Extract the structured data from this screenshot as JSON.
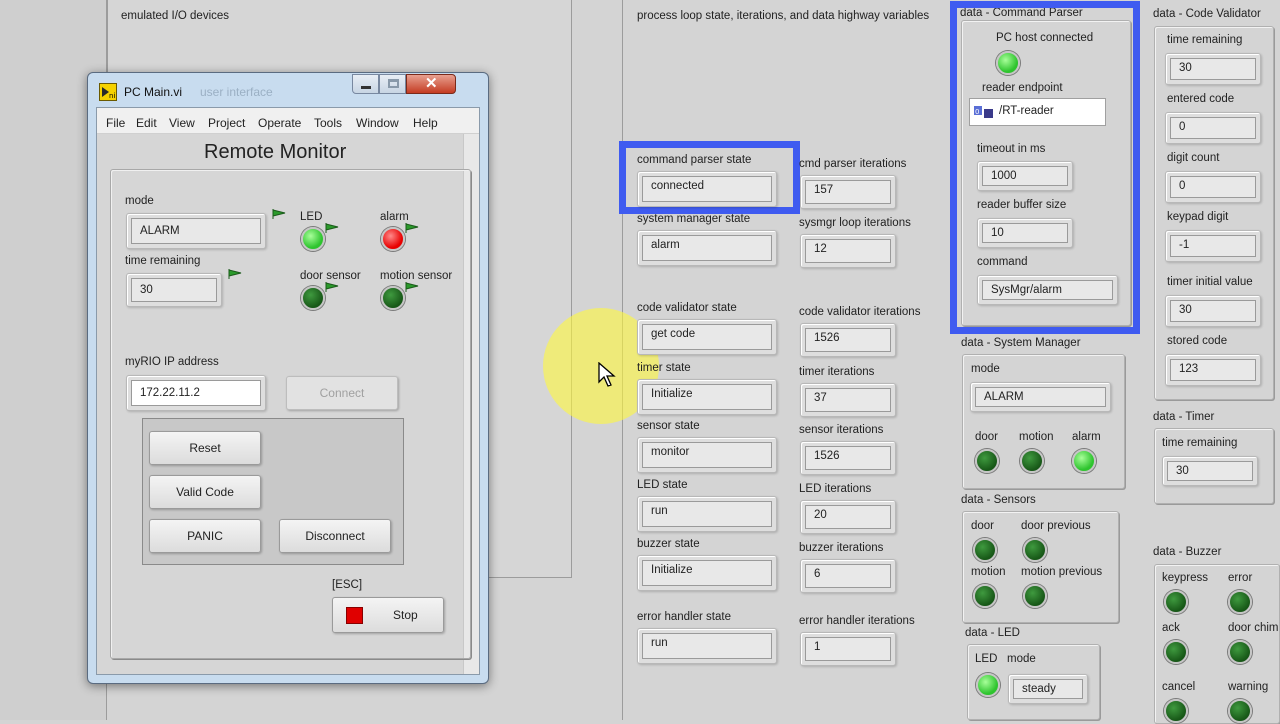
{
  "background": {
    "emulated_label": "emulated I/O devices",
    "process_label": "process loop state, iterations, and data highway variables"
  },
  "window": {
    "title": "PC Main.vi",
    "faded_title": "user interface",
    "menu": [
      "File",
      "Edit",
      "View",
      "Project",
      "Operate",
      "Tools",
      "Window",
      "Help"
    ],
    "heading": "Remote Monitor",
    "mode_label": "mode",
    "mode_value": "ALARM",
    "time_label": "time remaining",
    "time_value": "30",
    "led_label": "LED",
    "alarm_label": "alarm",
    "door_label": "door sensor",
    "motion_label": "motion sensor",
    "ip_label": "myRIO IP address",
    "ip_value": "172.22.11.2",
    "connect": "Connect",
    "reset": "Reset",
    "valid_code": "Valid Code",
    "panic": "PANIC",
    "disconnect": "Disconnect",
    "esc": "[ESC]",
    "stop": "Stop"
  },
  "states": [
    {
      "label": "command parser state",
      "value": "connected"
    },
    {
      "label": "system manager state",
      "value": "alarm"
    },
    {
      "label": "code validator state",
      "value": "get code"
    },
    {
      "label": "timer state",
      "value": "Initialize"
    },
    {
      "label": "sensor state",
      "value": "monitor"
    },
    {
      "label": "LED state",
      "value": "run"
    },
    {
      "label": "buzzer state",
      "value": "Initialize"
    },
    {
      "label": "error handler state",
      "value": "run"
    }
  ],
  "iterations": [
    {
      "label": "cmd parser iterations",
      "value": "157"
    },
    {
      "label": "sysmgr loop iterations",
      "value": "12"
    },
    {
      "label": "code validator iterations",
      "value": "1526"
    },
    {
      "label": "timer iterations",
      "value": "37"
    },
    {
      "label": "sensor iterations",
      "value": "1526"
    },
    {
      "label": "LED iterations",
      "value": "20"
    },
    {
      "label": "buzzer iterations",
      "value": "6"
    },
    {
      "label": "error handler iterations",
      "value": "1"
    }
  ],
  "cmd_parser": {
    "title": "data - Command Parser",
    "pc_host_label": "PC host connected",
    "endpoint_label": "reader endpoint",
    "endpoint_value": "/RT-reader",
    "timeout_label": "timeout in ms",
    "timeout_value": "1000",
    "buffer_label": "reader buffer size",
    "buffer_value": "10",
    "command_label": "command",
    "command_value": "SysMgr/alarm"
  },
  "sys_manager": {
    "title": "data - System Manager",
    "mode_label": "mode",
    "mode_value": "ALARM",
    "door": "door",
    "motion": "motion",
    "alarm": "alarm"
  },
  "sensors": {
    "title": "data - Sensors",
    "door": "door",
    "door_prev": "door previous",
    "motion": "motion",
    "motion_prev": "motion previous"
  },
  "led_data": {
    "title": "data - LED",
    "led": "LED",
    "mode_label": "mode",
    "mode_value": "steady"
  },
  "code_validator": {
    "title": "data - Code Validator",
    "time_label": "time remaining",
    "time_value": "30",
    "entered_label": "entered code",
    "entered_value": "0",
    "digit_count_label": "digit count",
    "digit_count_value": "0",
    "keypad_label": "keypad digit",
    "keypad_value": "-1",
    "timer_init_label": "timer initial value",
    "timer_init_value": "30",
    "stored_label": "stored code",
    "stored_value": "123"
  },
  "timer_data": {
    "title": "data - Timer",
    "time_label": "time remaining",
    "time_value": "30"
  },
  "buzzer": {
    "title": "data - Buzzer",
    "keypress": "keypress",
    "error": "error",
    "ack": "ack",
    "door_chime": "door chim",
    "cancel": "cancel",
    "warning": "warning"
  },
  "colors": {
    "highlight": "#3f5bf0",
    "led_on": "#2ec42e",
    "led_off": "#175717",
    "alarm_red": "#e80000"
  }
}
